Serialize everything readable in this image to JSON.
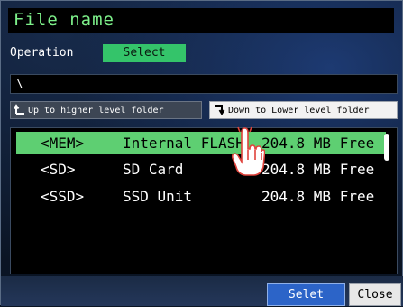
{
  "dialog": {
    "title": "File name",
    "operation_label": "Operation",
    "operation_value": "Select",
    "path": "\\"
  },
  "nav": {
    "up_label": "Up to higher level folder",
    "down_label": "Down to Lower level folder"
  },
  "list": {
    "rows": [
      {
        "tag": "<MEM>",
        "name": "Internal FLASH",
        "free": "204.8 MB Free",
        "selected": true
      },
      {
        "tag": "<SD>",
        "name": "SD Card",
        "free": "204.8 MB Free",
        "selected": false
      },
      {
        "tag": "<SSD>",
        "name": "SSD Unit",
        "free": "204.8 MB Free",
        "selected": false
      }
    ]
  },
  "buttons": {
    "select_label": "Selet",
    "close_label": "Close"
  },
  "colors": {
    "title_text": "#7df08a",
    "operation_button": "#34c46a",
    "selected_row": "#5ecf72",
    "select_button": "#2c64c8"
  },
  "icons": {
    "up": "folder-up-arrow-icon",
    "down": "folder-down-arrow-icon",
    "cursor": "hand-pointer-icon"
  }
}
